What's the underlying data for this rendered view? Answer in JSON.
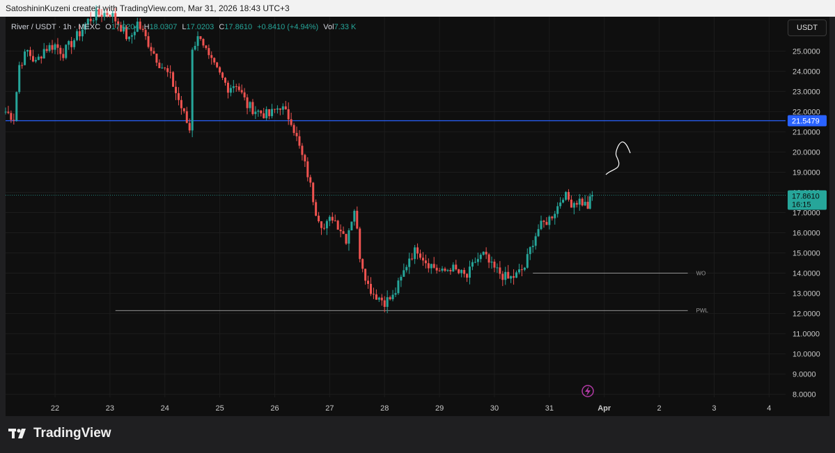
{
  "header": {
    "attribution": "SatoshininKuzeni created with TradingView.com, Mar 31, 2026 18:43 UTC+3"
  },
  "legend": {
    "symbol": "River / USDT · 1h · MEXC",
    "open_label": "O",
    "open": "17.0204",
    "high_label": "H",
    "high": "18.0307",
    "low_label": "L",
    "low": "17.0203",
    "close_label": "C",
    "close": "17.8610",
    "change": "+0.8410 (+4.94%)",
    "vol_label": "Vol",
    "vol": "7.33 K"
  },
  "currency_button": "USDT",
  "brand": {
    "name": "TradingView",
    "logo_icon": "tradingview-logo-icon"
  },
  "colors": {
    "up": "#26a69a",
    "down": "#ef5350",
    "hline": "#2962ff",
    "last_price_bg": "#26a69a"
  },
  "chart_data": {
    "type": "candlestick",
    "yaxis": {
      "ticks": [
        "25.0000",
        "24.0000",
        "23.0000",
        "22.0000",
        "21.0000",
        "20.0000",
        "19.0000",
        "18.0000",
        "17.0000",
        "16.0000",
        "15.0000",
        "14.0000",
        "13.0000",
        "12.0000",
        "11.0000",
        "10.0000",
        "9.0000",
        "8.0000"
      ],
      "range": [
        7.85,
        26.7
      ]
    },
    "xaxis": {
      "ticks": [
        "22",
        "23",
        "24",
        "25",
        "26",
        "27",
        "28",
        "29",
        "30",
        "31",
        "Apr",
        "2",
        "3",
        "4"
      ],
      "range_days": [
        21.1,
        35.3
      ]
    },
    "series_path": [
      [
        21.1,
        22.0
      ],
      [
        21.25,
        21.7
      ],
      [
        21.35,
        24.3
      ],
      [
        21.5,
        25.0
      ],
      [
        21.65,
        24.4
      ],
      [
        21.8,
        25.1
      ],
      [
        22.0,
        25.3
      ],
      [
        22.15,
        24.9
      ],
      [
        22.3,
        25.4
      ],
      [
        22.45,
        25.9
      ],
      [
        22.6,
        26.5
      ],
      [
        22.75,
        26.8
      ],
      [
        23.0,
        26.9
      ],
      [
        23.2,
        26.2
      ],
      [
        23.35,
        25.5
      ],
      [
        23.5,
        26.4
      ],
      [
        23.7,
        25.4
      ],
      [
        23.9,
        24.4
      ],
      [
        24.1,
        23.7
      ],
      [
        24.3,
        22.2
      ],
      [
        24.45,
        21.1
      ],
      [
        24.5,
        25.2
      ],
      [
        24.65,
        25.8
      ],
      [
        24.8,
        24.6
      ],
      [
        25.0,
        23.8
      ],
      [
        25.15,
        23.2
      ],
      [
        25.3,
        23.4
      ],
      [
        25.5,
        22.3
      ],
      [
        25.7,
        22.0
      ],
      [
        25.9,
        21.8
      ],
      [
        26.1,
        22.3
      ],
      [
        26.2,
        21.9
      ],
      [
        26.3,
        21.6
      ],
      [
        26.45,
        20.2
      ],
      [
        26.6,
        18.9
      ],
      [
        26.75,
        17.1
      ],
      [
        26.9,
        16.2
      ],
      [
        27.05,
        16.8
      ],
      [
        27.2,
        16.2
      ],
      [
        27.3,
        15.7
      ],
      [
        27.45,
        17.2
      ],
      [
        27.55,
        14.9
      ],
      [
        27.7,
        13.4
      ],
      [
        27.8,
        13.0
      ],
      [
        28.0,
        12.6
      ],
      [
        28.15,
        12.8
      ],
      [
        28.3,
        13.7
      ],
      [
        28.45,
        14.8
      ],
      [
        28.6,
        15.2
      ],
      [
        28.75,
        14.6
      ],
      [
        28.9,
        14.3
      ],
      [
        29.05,
        14.0
      ],
      [
        29.2,
        14.3
      ],
      [
        29.35,
        14.0
      ],
      [
        29.5,
        13.8
      ],
      [
        29.65,
        14.6
      ],
      [
        29.8,
        14.9
      ],
      [
        29.95,
        14.3
      ],
      [
        30.1,
        14.0
      ],
      [
        30.25,
        13.7
      ],
      [
        30.4,
        13.9
      ],
      [
        30.55,
        14.3
      ],
      [
        30.7,
        15.6
      ],
      [
        30.8,
        16.2
      ],
      [
        31.0,
        16.7
      ],
      [
        31.15,
        17.3
      ],
      [
        31.25,
        17.9
      ],
      [
        31.4,
        17.5
      ],
      [
        31.55,
        17.6
      ],
      [
        31.7,
        17.3
      ],
      [
        31.78,
        17.86
      ]
    ],
    "horizontal_lines": [
      {
        "price": 21.5479,
        "label": "21.5479",
        "color": "#2962ff"
      },
      {
        "price": 14.0,
        "label": "WO",
        "start_day": 30.7,
        "end_day": 33.52
      },
      {
        "price": 12.15,
        "label": "PWL",
        "start_day": 23.1,
        "end_day": 33.52
      }
    ],
    "last_price": {
      "price": 17.861,
      "label": "17.8610",
      "countdown": "16:15"
    },
    "annotation": "hand-drawn upward arrow"
  }
}
